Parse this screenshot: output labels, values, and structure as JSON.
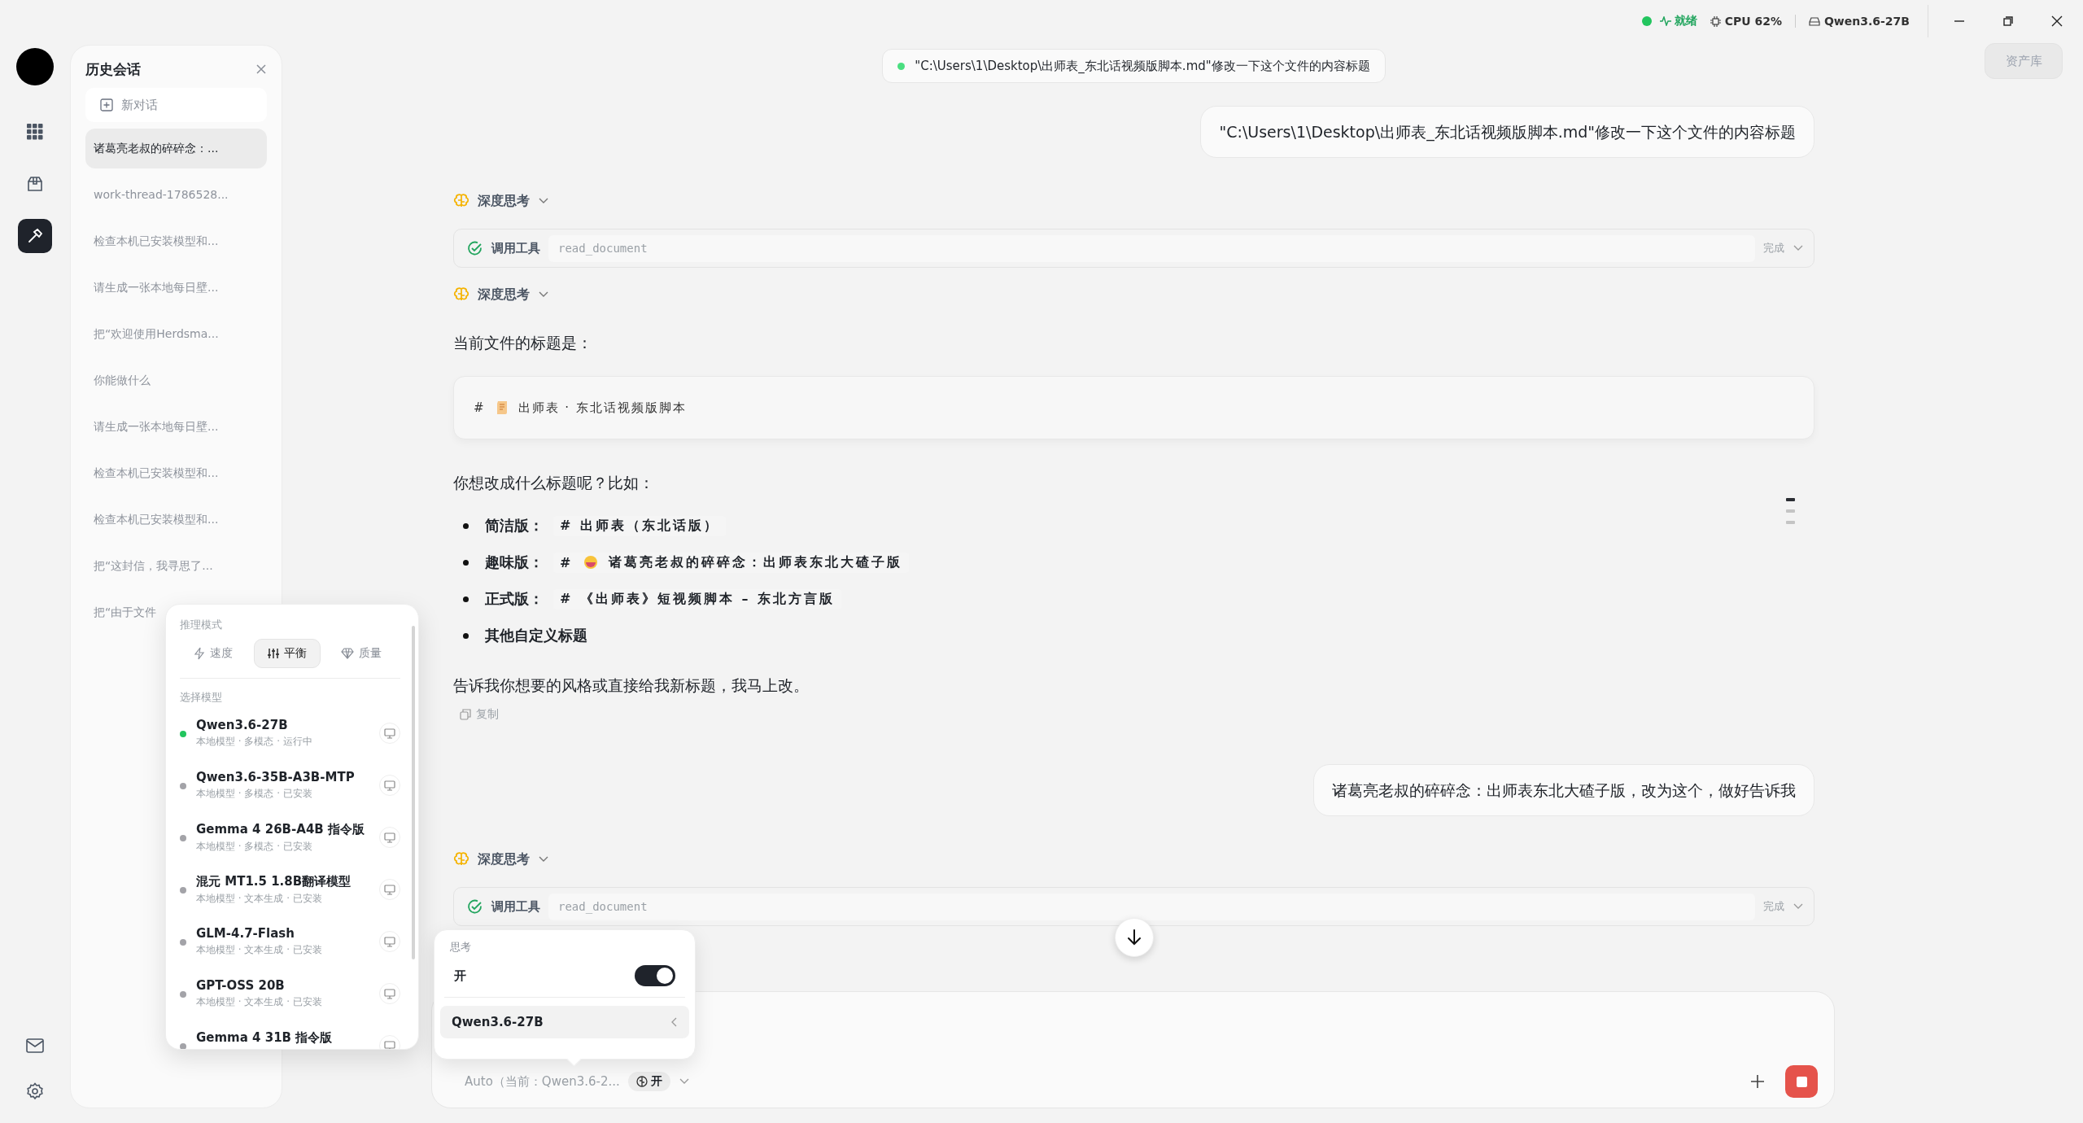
{
  "rail": {
    "items": [
      {
        "kind": "grid",
        "selected": false
      },
      {
        "kind": "box",
        "selected": false
      },
      {
        "kind": "hammer",
        "selected": true
      }
    ],
    "bottom": [
      {
        "kind": "mail"
      },
      {
        "kind": "settings"
      }
    ]
  },
  "history": {
    "title": "历史会话",
    "new_chat": "新对话",
    "items": [
      {
        "label": "诸葛亮老叔的碎碎念：...",
        "selected": true
      },
      {
        "label": "work-thread-1786528...",
        "selected": false
      },
      {
        "label": "检查本机已安装模型和...",
        "selected": false
      },
      {
        "label": "请生成一张本地每日壁...",
        "selected": false
      },
      {
        "label": "把“欢迎使用Herdsma...",
        "selected": false
      },
      {
        "label": "你能做什么",
        "selected": false
      },
      {
        "label": "请生成一张本地每日壁...",
        "selected": false
      },
      {
        "label": "检查本机已安装模型和...",
        "selected": false
      },
      {
        "label": "检查本机已安装模型和...",
        "selected": false
      },
      {
        "label": "把“这封信，我寻思了...",
        "selected": false
      },
      {
        "label": "把“由于文件",
        "selected": false
      }
    ]
  },
  "status": {
    "ready": "就绪",
    "cpu": "CPU 62%",
    "model": "Qwen3.6-27B"
  },
  "top_pill": "\"C:\\Users\\1\\Desktop\\出师表_东北话视频版脚本.md\"修改一下这个文件的内容标题",
  "asset_button": "资产库",
  "messages": [
    {
      "kind": "user",
      "text": "\"C:\\Users\\1\\Desktop\\出师表_东北话视频版脚本.md\"修改一下这个文件的内容标题"
    },
    {
      "kind": "thinking",
      "text": "深度思考"
    },
    {
      "kind": "tool",
      "label": "调用工具",
      "name": "read_document",
      "state": "完成"
    },
    {
      "kind": "thinking",
      "text": "深度思考"
    },
    {
      "kind": "text",
      "text": "当前文件的标题是："
    },
    {
      "kind": "code",
      "prefix": "#",
      "text": "出师表 · 东北话视频版脚本"
    },
    {
      "kind": "text",
      "text": "你想改成什么标题呢？比如："
    },
    {
      "kind": "list",
      "items": [
        {
          "kind": "code",
          "label": "简洁版",
          "sep": "：",
          "code": "# 出师表（东北话版）"
        },
        {
          "kind": "emoji",
          "label": "趣味版",
          "sep": "：",
          "prefix": "#",
          "code": "诸葛亮老叔的碎碎念：出师表东北大碴子版"
        },
        {
          "kind": "code",
          "label": "正式版",
          "sep": "：",
          "code": "# 《出师表》短视频脚本 – 东北方言版"
        },
        {
          "kind": "plain",
          "label": "其他自定义标题"
        }
      ]
    },
    {
      "kind": "text",
      "text": "告诉我你想要的风格或直接给我新标题，我马上改。"
    },
    {
      "kind": "copy",
      "text": "复制"
    },
    {
      "kind": "user",
      "text": "诸葛亮老叔的碎碎念：出师表东北大碴子版，改为这个，做好告诉我"
    },
    {
      "kind": "thinking",
      "text": "深度思考"
    },
    {
      "kind": "tool",
      "label": "调用工具",
      "name": "read_document",
      "state": "完成"
    }
  ],
  "scroll_marks": [
    {
      "selected": true
    },
    {
      "selected": false
    },
    {
      "selected": false
    }
  ],
  "composer": {
    "model_label": "Auto（当前：Qwen3.6-2...",
    "think_chip": "开"
  },
  "model_popover": {
    "mode_label": "推理模式",
    "modes": [
      {
        "kind": "speed",
        "label": "速度",
        "selected": false
      },
      {
        "kind": "balance",
        "label": "平衡",
        "selected": true
      },
      {
        "kind": "quality",
        "label": "质量",
        "selected": false
      }
    ],
    "section": "选择模型",
    "models": [
      {
        "name": "Qwen3.6-27B",
        "meta": "本地模型 · 多模态 · 运行中",
        "color": "#22c55e"
      },
      {
        "name": "Qwen3.6-35B-A3B-MTP",
        "meta": "本地模型 · 多模态 · 已安装",
        "color": "#a3a3a8"
      },
      {
        "name": "Gemma 4 26B-A4B 指令版",
        "meta": "本地模型 · 多模态 · 已安装",
        "color": "#a3a3a8"
      },
      {
        "name": "混元 MT1.5 1.8B翻译模型",
        "meta": "本地模型 · 文本生成 · 已安装",
        "color": "#a3a3a8"
      },
      {
        "name": "GLM-4.7-Flash",
        "meta": "本地模型 · 文本生成 · 已安装",
        "color": "#a3a3a8"
      },
      {
        "name": "GPT-OSS 20B",
        "meta": "本地模型 · 文本生成 · 已安装",
        "color": "#a3a3a8"
      },
      {
        "name": "Gemma 4 31B 指令版",
        "color": "#a3a3a8"
      }
    ]
  },
  "think_popover": {
    "title": "思考",
    "toggle_label": "开",
    "on": true,
    "model": "Qwen3.6-27B"
  }
}
